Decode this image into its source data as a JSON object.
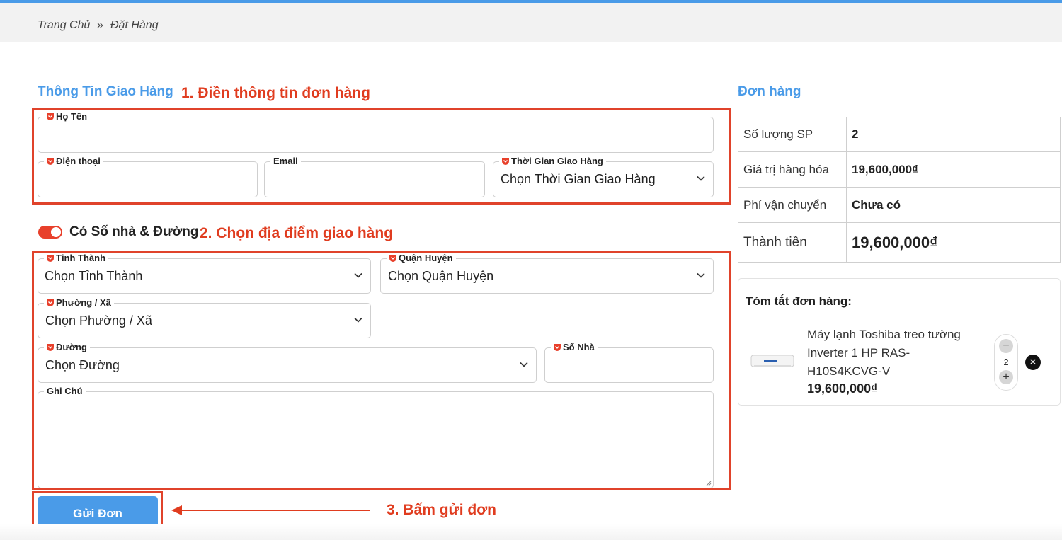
{
  "breadcrumb": {
    "home": "Trang Chủ",
    "separator": "»",
    "current": "Đặt Hàng"
  },
  "shipping_section": {
    "title": "Thông Tin Giao Hàng"
  },
  "annotations": {
    "step1": "1. Điền thông tin đơn hàng",
    "step2": "2. Chọn địa điểm giao hàng",
    "step3": "3. Bấm gửi đơn"
  },
  "form": {
    "name": {
      "label": "Họ Tên",
      "value": ""
    },
    "phone": {
      "label": "Điện thoại",
      "value": ""
    },
    "email": {
      "label": "Email",
      "value": ""
    },
    "delivery_time": {
      "label": "Thời Gian Giao Hàng",
      "value": "Chọn Thời Gian Giao Hàng"
    },
    "address_toggle": {
      "label": "Có Số nhà & Đường",
      "on": true
    },
    "province": {
      "label": "Tỉnh Thành",
      "value": "Chọn Tỉnh Thành"
    },
    "district": {
      "label": "Quận Huyện",
      "value": "Chọn Quận Huyện"
    },
    "ward": {
      "label": "Phường / Xã",
      "value": "Chọn Phường / Xã"
    },
    "street": {
      "label": "Đường",
      "value": "Chọn Đường"
    },
    "house_number": {
      "label": "Số Nhà",
      "value": ""
    },
    "note": {
      "label": "Ghi Chú",
      "value": ""
    },
    "submit_label": "Gửi Đơn"
  },
  "order": {
    "title": "Đơn hàng",
    "rows": [
      {
        "label": "Số lượng SP",
        "value": "2"
      },
      {
        "label": "Giá trị hàng hóa",
        "value": "19,600,000₫"
      },
      {
        "label": "Phí vận chuyển",
        "value": "Chưa có"
      },
      {
        "label": "Thành tiền",
        "value": "19,600,000₫"
      }
    ],
    "summary_title": "Tóm tắt đơn hàng:",
    "item": {
      "name": "Máy lạnh Toshiba treo tường Inverter 1 HP RAS-H10S4KCVG-V",
      "price": "19,600,000₫",
      "quantity": "2",
      "minus": "−",
      "plus": "+",
      "remove": "✕"
    }
  },
  "colors": {
    "accent": "#4a9be8",
    "annotation": "#e03c1f",
    "required": "#e8402b"
  }
}
